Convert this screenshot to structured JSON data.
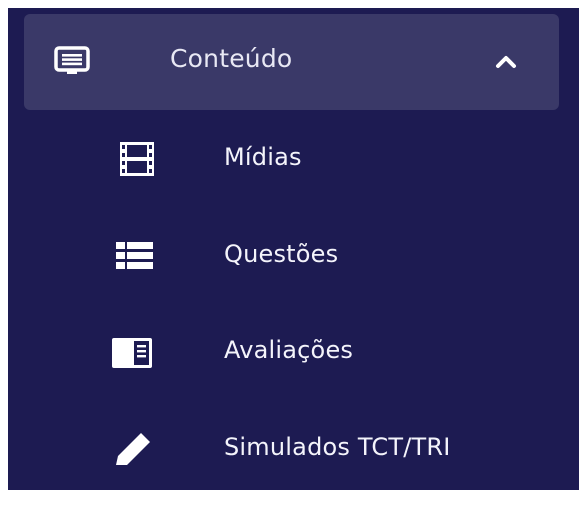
{
  "menu": {
    "group": {
      "label": "Conteúdo",
      "icon": "monitor-list-icon",
      "expanded": true
    },
    "items": [
      {
        "label": "Mídias",
        "icon": "film-icon"
      },
      {
        "label": "Questões",
        "icon": "list-icon"
      },
      {
        "label": "Avaliações",
        "icon": "book-icon"
      },
      {
        "label": "Simulados TCT/TRI",
        "icon": "pencil-icon"
      }
    ]
  },
  "colors": {
    "background": "#1d1b52",
    "header": "#3a3968",
    "text": "#f4f4fb"
  }
}
